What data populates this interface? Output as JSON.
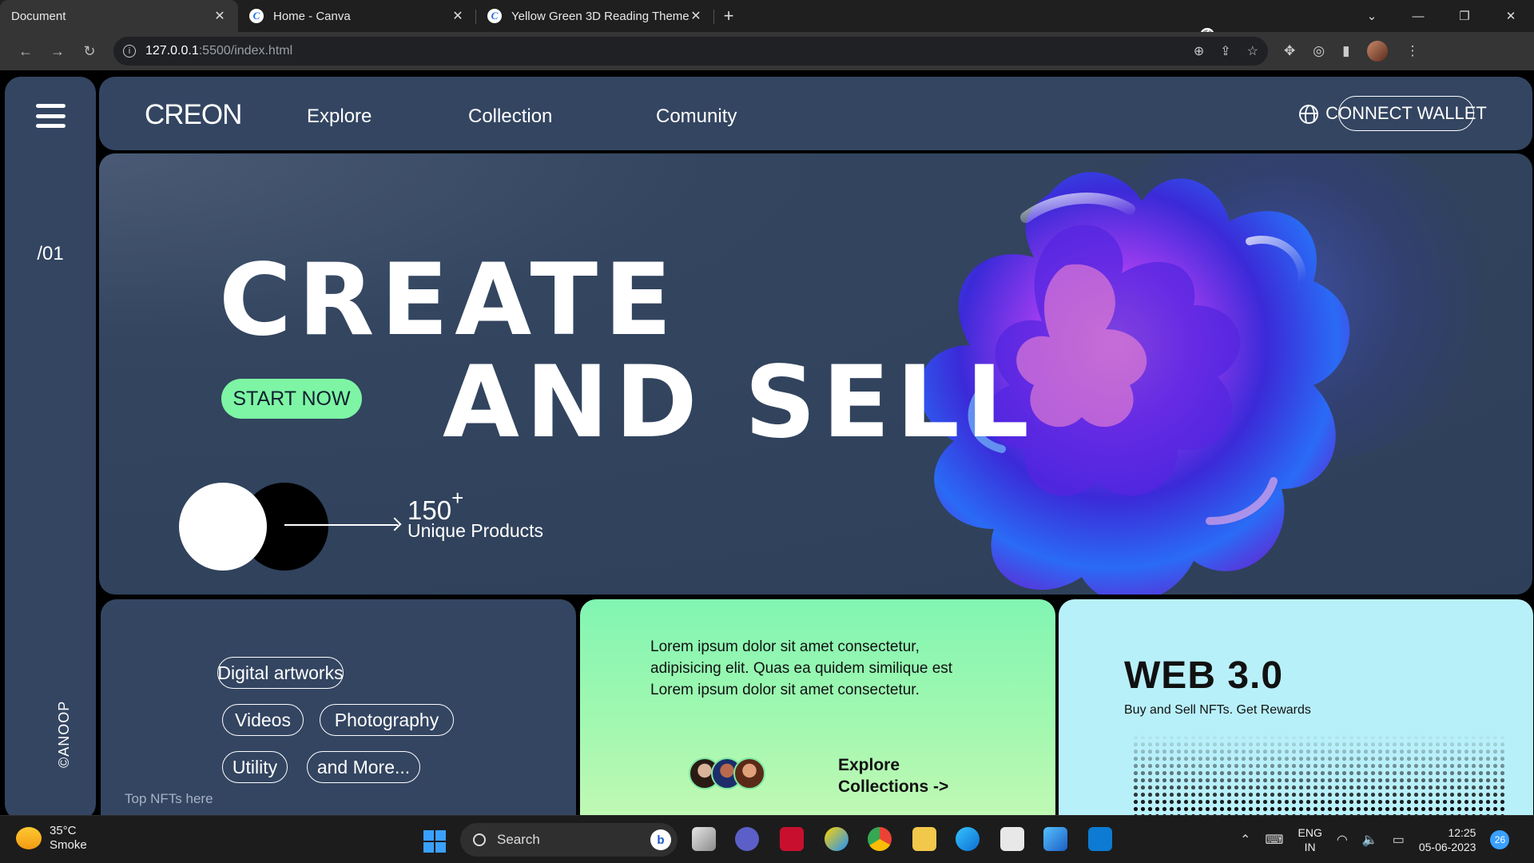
{
  "browser": {
    "tabs": [
      {
        "title": "Document",
        "active": true,
        "icon": "globe-icon"
      },
      {
        "title": "Home - Canva",
        "active": false,
        "icon": "canva-icon"
      },
      {
        "title": "Yellow Green 3D Reading Theme",
        "active": false,
        "icon": "canva-icon"
      }
    ],
    "url_host": "127.0.0.1",
    "url_path": ":5500/index.html"
  },
  "sidebar": {
    "page_number": "/01",
    "credit": "©ANOOP"
  },
  "nav": {
    "brand": "CREON",
    "links": [
      "Explore",
      "Collection",
      "Comunity"
    ],
    "connect_label": "CONNECT WALLET"
  },
  "hero": {
    "line1": "CREATE",
    "line2": "AND SELL",
    "cta_label": "START NOW",
    "count": "150",
    "count_suffix": "+",
    "count_label": "Unique Products"
  },
  "categories": {
    "pills": [
      "Digital artworks",
      "Videos",
      "Photography",
      "Utility",
      "and More..."
    ],
    "caption": "Top NFTs here"
  },
  "promo": {
    "text": "Lorem ipsum dolor sit amet consectetur, adipisicing elit. Quas ea quidem similique est Lorem ipsum dolor sit amet consectetur.",
    "cta_line1": "Explore",
    "cta_line2": "Collections ->"
  },
  "web3": {
    "title": "WEB 3.0",
    "subtitle": "Buy and Sell NFTs. Get Rewards"
  },
  "taskbar": {
    "temp": "35°C",
    "weather": "Smoke",
    "search_label": "Search",
    "lang_top": "ENG",
    "lang_bottom": "IN",
    "time": "12:25",
    "date": "05-06-2023",
    "notifications": "26"
  },
  "colors": {
    "panel": "#334561",
    "accent_green": "#7df5a4",
    "web3_card": "#b8f0fa"
  }
}
